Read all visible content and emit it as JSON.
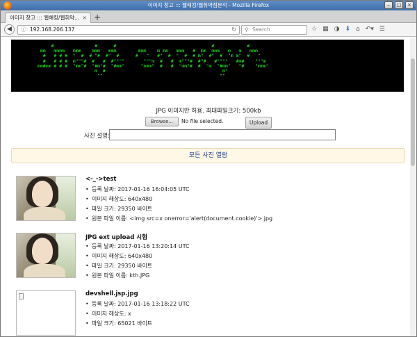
{
  "window": {
    "title": "이미지 창고 ::: 웹해킹/웹취약점분석 - Mozilla Firefox",
    "controls": [
      "–",
      "□",
      "×"
    ]
  },
  "tab": {
    "label": "이미지 창고 ::: 웹해킹/웹취약...",
    "close": "×",
    "new_tab": "+"
  },
  "nav": {
    "url": "192.168.206.137",
    "search_placeholder": "Search",
    "icons": [
      "star-icon",
      "clipboard-icon",
      "pocket-icon",
      "download-icon",
      "home-icon",
      "back-history-icon",
      "menu-icon"
    ]
  },
  "page": {
    "banner_ascii": "      #               #      #                                   #            #\n  mm   mmmm   mmm    mmm   mmm        mmm    m mm   mmm   #  mm  mmm   m   m   mmm\n   #   # # #  \"  #  # \"#  #\"  #      #   \"   #\"  #  \"  #  # m\"  #\"  #  \"m m\"  #   \"\n   #   # # #  m\"\"\"#  #   #  #\"\"\"\"       \"\"\"m  #   #  m\"\"\"#  #\"#   #\"\"\"\"   #m#    \"\"\"m\n mm#mm # # #  \"mm\"#  \"#m\"#  \"#mm\"      \"mmm\"  #   #  \"mm\"#  #  \"m  \"#mm\"   \"#    \"mmm\"\n                      m  #                                           m\"\n                       \"\"                                           \"\"",
    "upload_info": "JPG 이미지만 허용. 최대파일크기: 500kb",
    "browse_label": "Browse...",
    "no_file": "No file selected.",
    "upload_label": "Upload",
    "desc_label": "사진 설명:",
    "desc_value": "",
    "view_all": "모든 사진 열람"
  },
  "entries": [
    {
      "title": "<-_->test",
      "date": "등록 날짜: 2017-01-16 16:04:05 UTC",
      "resolution": "이미지 해상도: 640x480",
      "size": "파일 크기: 29350 바이트",
      "filename": "원본 파일 이름: <img src=x onerror='alert(document.cookie)'>.jpg"
    },
    {
      "title": "JPG ext upload 시험",
      "date": "등록 날짜: 2017-01-16 13:20:14 UTC",
      "resolution": "이미지 해상도: 640x480",
      "size": "파일 크기: 29350 바이트",
      "filename": "원본 파일 이름: kth.JPG"
    },
    {
      "title": "devshell.jsp.jpg",
      "date": "등록 날짜: 2017-01-16 13:18:22 UTC",
      "resolution": "이미지 해상도: x",
      "size": "파일 크기: 65021 바이트"
    }
  ]
}
